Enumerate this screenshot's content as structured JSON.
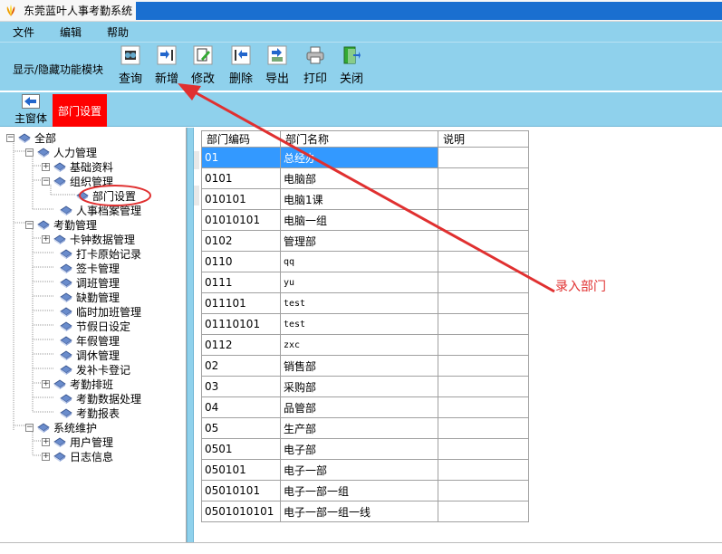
{
  "window": {
    "title": "东莞蓝叶人事考勤系统"
  },
  "menu": {
    "items": [
      "文件",
      "编辑",
      "帮助"
    ]
  },
  "toolbar": {
    "module_label": "显示/隐藏功能模块",
    "buttons": [
      {
        "label": "查询",
        "icon": "query-icon"
      },
      {
        "label": "新增",
        "icon": "add-icon"
      },
      {
        "label": "修改",
        "icon": "edit-icon"
      },
      {
        "label": "删除",
        "icon": "delete-icon"
      },
      {
        "label": "导出",
        "icon": "export-icon"
      },
      {
        "label": "打印",
        "icon": "print-icon"
      },
      {
        "label": "关闭",
        "icon": "close-icon"
      }
    ]
  },
  "tabs": {
    "home_label": "主窗体",
    "active_label": "部门设置",
    "active_color": "#ff0000"
  },
  "tree": {
    "nodes": [
      {
        "label": "全部"
      },
      {
        "label": "人力管理"
      },
      {
        "label": "基础资料"
      },
      {
        "label": "组织管理"
      },
      {
        "label": "部门设置"
      },
      {
        "label": "人事档案管理"
      },
      {
        "label": "考勤管理"
      },
      {
        "label": "卡钟数据管理"
      },
      {
        "label": "打卡原始记录"
      },
      {
        "label": "签卡管理"
      },
      {
        "label": "调班管理"
      },
      {
        "label": "缺勤管理"
      },
      {
        "label": "临时加班管理"
      },
      {
        "label": "节假日设定"
      },
      {
        "label": "年假管理"
      },
      {
        "label": "调休管理"
      },
      {
        "label": "发补卡登记"
      },
      {
        "label": "考勤排班"
      },
      {
        "label": "考勤数据处理"
      },
      {
        "label": "考勤报表"
      },
      {
        "label": "系统维护"
      },
      {
        "label": "用户管理"
      },
      {
        "label": "日志信息"
      }
    ]
  },
  "grid": {
    "columns": [
      "部门编码",
      "部门名称",
      "说明"
    ],
    "rows": [
      {
        "code": "01",
        "name": "总经办",
        "desc": ""
      },
      {
        "code": "0101",
        "name": "电脑部",
        "desc": ""
      },
      {
        "code": "010101",
        "name": "电脑1课",
        "desc": ""
      },
      {
        "code": "01010101",
        "name": "电脑一组",
        "desc": ""
      },
      {
        "code": "0102",
        "name": "管理部",
        "desc": ""
      },
      {
        "code": "0110",
        "name": "qq",
        "desc": ""
      },
      {
        "code": "0111",
        "name": "yu",
        "desc": ""
      },
      {
        "code": "011101",
        "name": "test",
        "desc": ""
      },
      {
        "code": "01110101",
        "name": "test",
        "desc": ""
      },
      {
        "code": "0112",
        "name": "zxc",
        "desc": ""
      },
      {
        "code": "02",
        "name": "销售部",
        "desc": ""
      },
      {
        "code": "03",
        "name": "采购部",
        "desc": ""
      },
      {
        "code": "04",
        "name": "品管部",
        "desc": ""
      },
      {
        "code": "05",
        "name": "生产部",
        "desc": ""
      },
      {
        "code": "0501",
        "name": "电子部",
        "desc": ""
      },
      {
        "code": "050101",
        "name": "电子一部",
        "desc": ""
      },
      {
        "code": "05010101",
        "name": "电子一部一组",
        "desc": ""
      },
      {
        "code": "0501010101",
        "name": "电子一部一组一线",
        "desc": ""
      }
    ],
    "selected_row_index": 0,
    "selection_color": "#3399ff"
  },
  "annotation": {
    "text": "录入部门",
    "color": "#e03030"
  },
  "colors": {
    "toolbar_bg": "#8fd1ec",
    "title_fill": "#1a6fd0"
  }
}
